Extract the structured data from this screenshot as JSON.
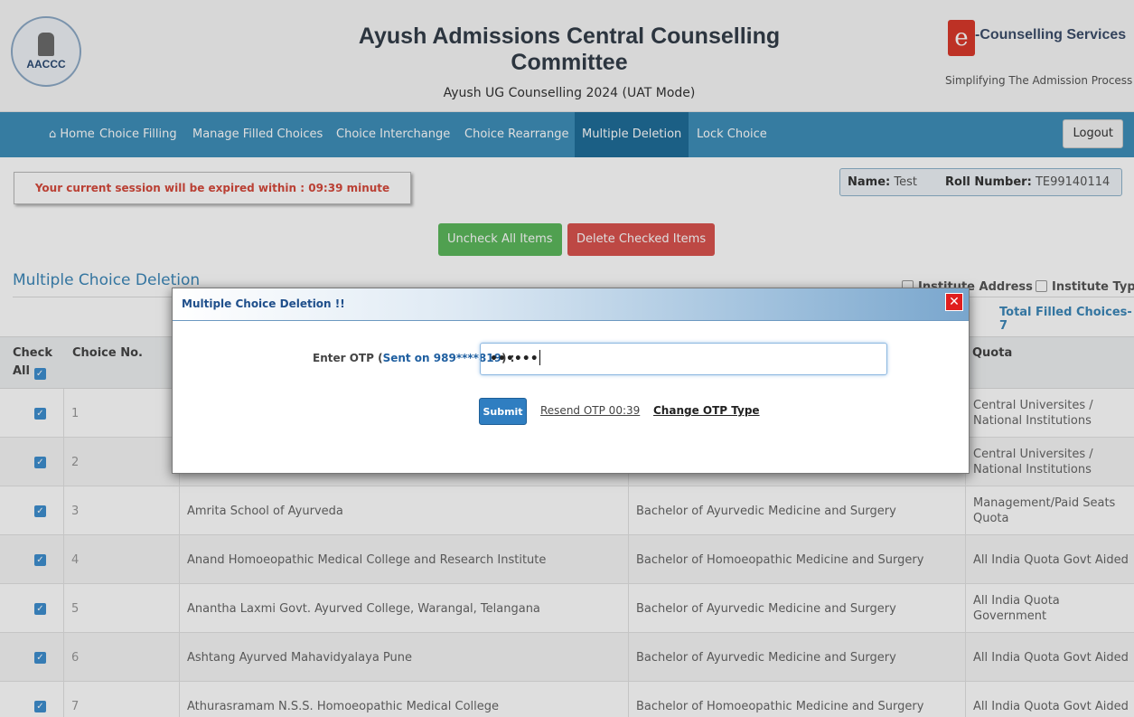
{
  "header": {
    "emblem_abbr": "AACCC",
    "title": "Ayush Admissions Central Counselling Committee",
    "subtitle": "Ayush UG Counselling 2024 (UAT Mode)",
    "brand_glyph": "e",
    "brand_name": "-Counselling Services",
    "brand_tagline": "Simplifying The Admission Process"
  },
  "nav": {
    "home": "Home",
    "items": [
      "Choice Filling",
      "Manage Filled Choices",
      "Choice Interchange",
      "Choice Rearrange",
      "Multiple Deletion",
      "Lock Choice"
    ],
    "active": "Multiple Deletion",
    "logout": "Logout"
  },
  "session": {
    "text": "Your current session will be expired within : 09:39 minute"
  },
  "user": {
    "name_label": "Name:",
    "name": "Test",
    "roll_label": "Roll Number:",
    "roll": "TE99140114"
  },
  "actions": {
    "uncheck_all": "Uncheck All Items",
    "delete_checked": "Delete Checked Items"
  },
  "section": {
    "title": "Multiple Choice Deletion",
    "filters": [
      "Institute Address",
      "Institute Type"
    ],
    "total": "Total Filled Choices-7"
  },
  "table": {
    "headers": {
      "check": "Check",
      "check_all": "All",
      "choice_no": "Choice No.",
      "quota": "Quota"
    },
    "rows": [
      {
        "no": "1",
        "institute": "",
        "course": "",
        "quota": "Central Universites / National Institutions"
      },
      {
        "no": "2",
        "institute": "",
        "course": "",
        "quota": "Central Universites / National Institutions"
      },
      {
        "no": "3",
        "institute": "Amrita School of Ayurveda",
        "course": "Bachelor of Ayurvedic Medicine and Surgery",
        "quota": "Management/Paid Seats Quota"
      },
      {
        "no": "4",
        "institute": "Anand Homoeopathic Medical College and Research Institute",
        "course": "Bachelor of Homoeopathic Medicine and Surgery",
        "quota": "All India Quota Govt Aided"
      },
      {
        "no": "5",
        "institute": "Anantha Laxmi Govt. Ayurved College, Warangal, Telangana",
        "course": "Bachelor of Ayurvedic Medicine and Surgery",
        "quota": "All India Quota Government"
      },
      {
        "no": "6",
        "institute": "Ashtang Ayurved Mahavidyalaya Pune",
        "course": "Bachelor of Ayurvedic Medicine and Surgery",
        "quota": "All India Quota Govt Aided"
      },
      {
        "no": "7",
        "institute": "Athurasramam N.S.S. Homoeopathic Medical College",
        "course": "Bachelor of Homoeopathic Medicine and Surgery",
        "quota": "All India Quota Govt Aided"
      }
    ]
  },
  "modal": {
    "title": "Multiple Choice Deletion !!",
    "close_glyph": "✕",
    "otp_label": "Enter OTP (",
    "otp_sent": "Sent on 989****819",
    "otp_label_end": ") :",
    "otp_value": "••••••",
    "submit": "Submit",
    "resend": "Resend OTP 00:39",
    "change_type": "Change OTP Type"
  },
  "colors": {
    "nav": "#3f8fb9",
    "nav_active": "#1f6e99",
    "accent": "#3c87b8",
    "danger": "#d9534f",
    "success": "#5cb85c"
  }
}
